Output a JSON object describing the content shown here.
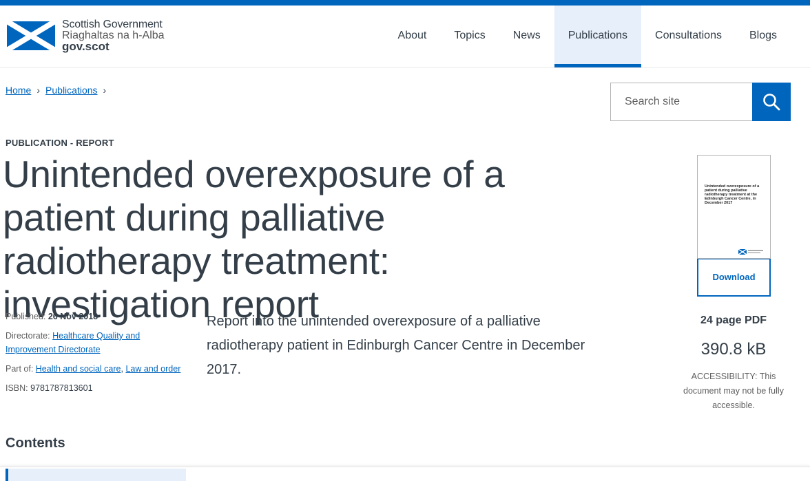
{
  "site": {
    "logo_line1": "Scottish Government",
    "logo_line2": "Riaghaltas na h-Alba",
    "logo_line3": "gov.scot",
    "brand_color": "#0065bd"
  },
  "nav": {
    "items": [
      {
        "label": "About",
        "active": false
      },
      {
        "label": "Topics",
        "active": false
      },
      {
        "label": "News",
        "active": false
      },
      {
        "label": "Publications",
        "active": true
      },
      {
        "label": "Consultations",
        "active": false
      },
      {
        "label": "Blogs",
        "active": false
      }
    ]
  },
  "breadcrumb": {
    "items": [
      "Home",
      "Publications"
    ],
    "separator": "›"
  },
  "search": {
    "placeholder": "Search site",
    "icon": "search-icon"
  },
  "publication": {
    "type_label": "PUBLICATION - REPORT",
    "title": "Unintended overexposure of a patient during palliative radiotherapy treatment: investigation report",
    "summary": "Report into the unintended overexposure of a palliative radiotherapy patient in Edinburgh Cancer Centre in December 2017."
  },
  "meta": {
    "published_label": "Published:",
    "published_value": "26 Nov 2018",
    "directorate_label": "Directorate:",
    "directorate_value": "Healthcare Quality and Improvement Directorate",
    "partof_label": "Part of:",
    "partof_links": [
      "Health and social care",
      "Law and order"
    ],
    "partof_sep": ",",
    "isbn_label": "ISBN:",
    "isbn_value": "9781787813601"
  },
  "document": {
    "thumb_title": "Unintended overexposure of a patient during palliative radiotherapy treatment at the Edinburgh Cancer Centre, in December 2017",
    "download_label": "Download",
    "pages": "24 page PDF",
    "size": "390.8 kB",
    "accessibility": "ACCESSIBILITY: This document may not be fully accessible."
  },
  "contents": {
    "heading": "Contents"
  }
}
